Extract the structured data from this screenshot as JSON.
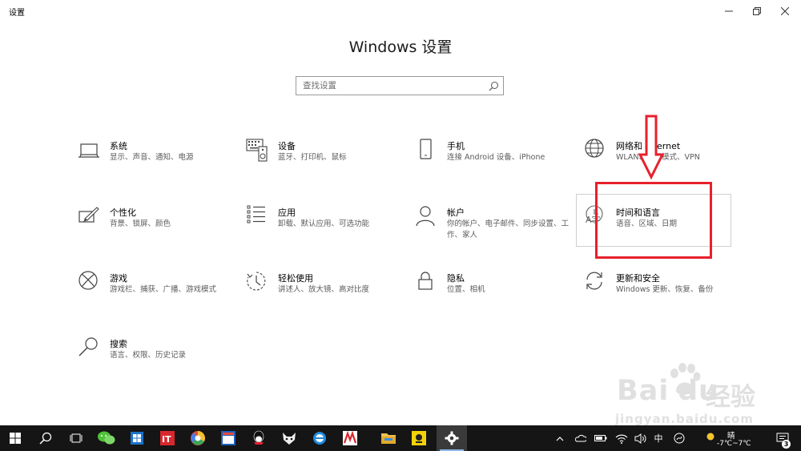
{
  "window": {
    "title": "设置",
    "controls": [
      "minimize-icon",
      "restore-icon",
      "close-icon"
    ]
  },
  "header": {
    "title": "Windows 设置"
  },
  "search": {
    "placeholder": "查找设置",
    "value": ""
  },
  "tiles": [
    {
      "icon": "laptop-icon",
      "title": "系统",
      "desc": "显示、声音、通知、电源"
    },
    {
      "icon": "keyboard-speaker-icon",
      "title": "设备",
      "desc": "蓝牙、打印机、鼠标"
    },
    {
      "icon": "phone-icon",
      "title": "手机",
      "desc": "连接 Android 设备、iPhone"
    },
    {
      "icon": "globe-icon",
      "title": "网络和 Internet",
      "desc": "WLAN、飞行模式、VPN"
    },
    {
      "icon": "paint-brush-icon",
      "title": "个性化",
      "desc": "背景、锁屏、颜色"
    },
    {
      "icon": "apps-list-icon",
      "title": "应用",
      "desc": "卸载、默认应用、可选功能"
    },
    {
      "icon": "person-icon",
      "title": "帐户",
      "desc": "你的帐户、电子邮件、同步设置、工作、家人"
    },
    {
      "icon": "clock-language-icon",
      "title": "时间和语言",
      "desc": "语音、区域、日期"
    },
    {
      "icon": "xbox-icon",
      "title": "游戏",
      "desc": "游戏栏、捕获、广播、游戏模式"
    },
    {
      "icon": "ease-of-access-icon",
      "title": "轻松使用",
      "desc": "讲述人、放大镜、高对比度"
    },
    {
      "icon": "lock-icon",
      "title": "隐私",
      "desc": "位置、相机"
    },
    {
      "icon": "update-sync-icon",
      "title": "更新和安全",
      "desc": "Windows 更新、恢复、备份"
    },
    {
      "icon": "search-magnifier-icon",
      "title": "搜索",
      "desc": "语言、权限、历史记录"
    }
  ],
  "annotation": {
    "color": "#e8202c"
  },
  "watermark": {
    "brand": "Bai",
    "brand_tail": "du",
    "cn": "经验",
    "url": "jingyan.baidu.com"
  },
  "taskbar": {
    "apps": [
      "windows-start-icon",
      "search-icon",
      "task-view-icon",
      "wechat-icon",
      "outlook-icon",
      "it-app-icon",
      "chrome-like-icon",
      "calendar-app-icon",
      "qq-icon",
      "fox-app-icon",
      "ie-icon",
      "adobe-icon",
      "file-explorer-icon",
      "notes-app-icon",
      "settings-gear-icon"
    ],
    "active_index": 14,
    "tray": {
      "ime": "中",
      "weather_condition": "晴",
      "temperature": "-7℃~7℃",
      "notification_count": "3"
    }
  },
  "colors": {
    "accent": "#0078d7",
    "taskbar_bg": "#151515",
    "text_secondary": "#5b5b5b"
  }
}
